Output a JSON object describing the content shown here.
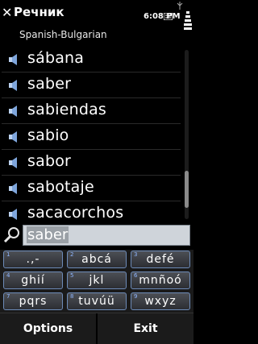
{
  "app": {
    "title": "Речник",
    "subtitle": "Spanish-Bulgarian"
  },
  "status": {
    "time": "6:08 PM"
  },
  "word_list": {
    "items": [
      {
        "word": "sábana"
      },
      {
        "word": "saber"
      },
      {
        "word": "sabiendas"
      },
      {
        "word": "sabio"
      },
      {
        "word": "sabor"
      },
      {
        "word": "sabotaje"
      },
      {
        "word": "sacacorchos"
      }
    ]
  },
  "search": {
    "value": "saber"
  },
  "keypad": {
    "keys": [
      {
        "num": "1",
        "label": ".,-"
      },
      {
        "num": "2",
        "label": "abcá"
      },
      {
        "num": "3",
        "label": "defé"
      },
      {
        "num": "4",
        "label": "ghií"
      },
      {
        "num": "5",
        "label": "jkl"
      },
      {
        "num": "6",
        "label": "mnñoó"
      },
      {
        "num": "7",
        "label": "pqrs"
      },
      {
        "num": "8",
        "label": "tuvúü"
      },
      {
        "num": "9",
        "label": "wxyz"
      }
    ]
  },
  "softkeys": {
    "left": "Options",
    "right": "Exit"
  }
}
